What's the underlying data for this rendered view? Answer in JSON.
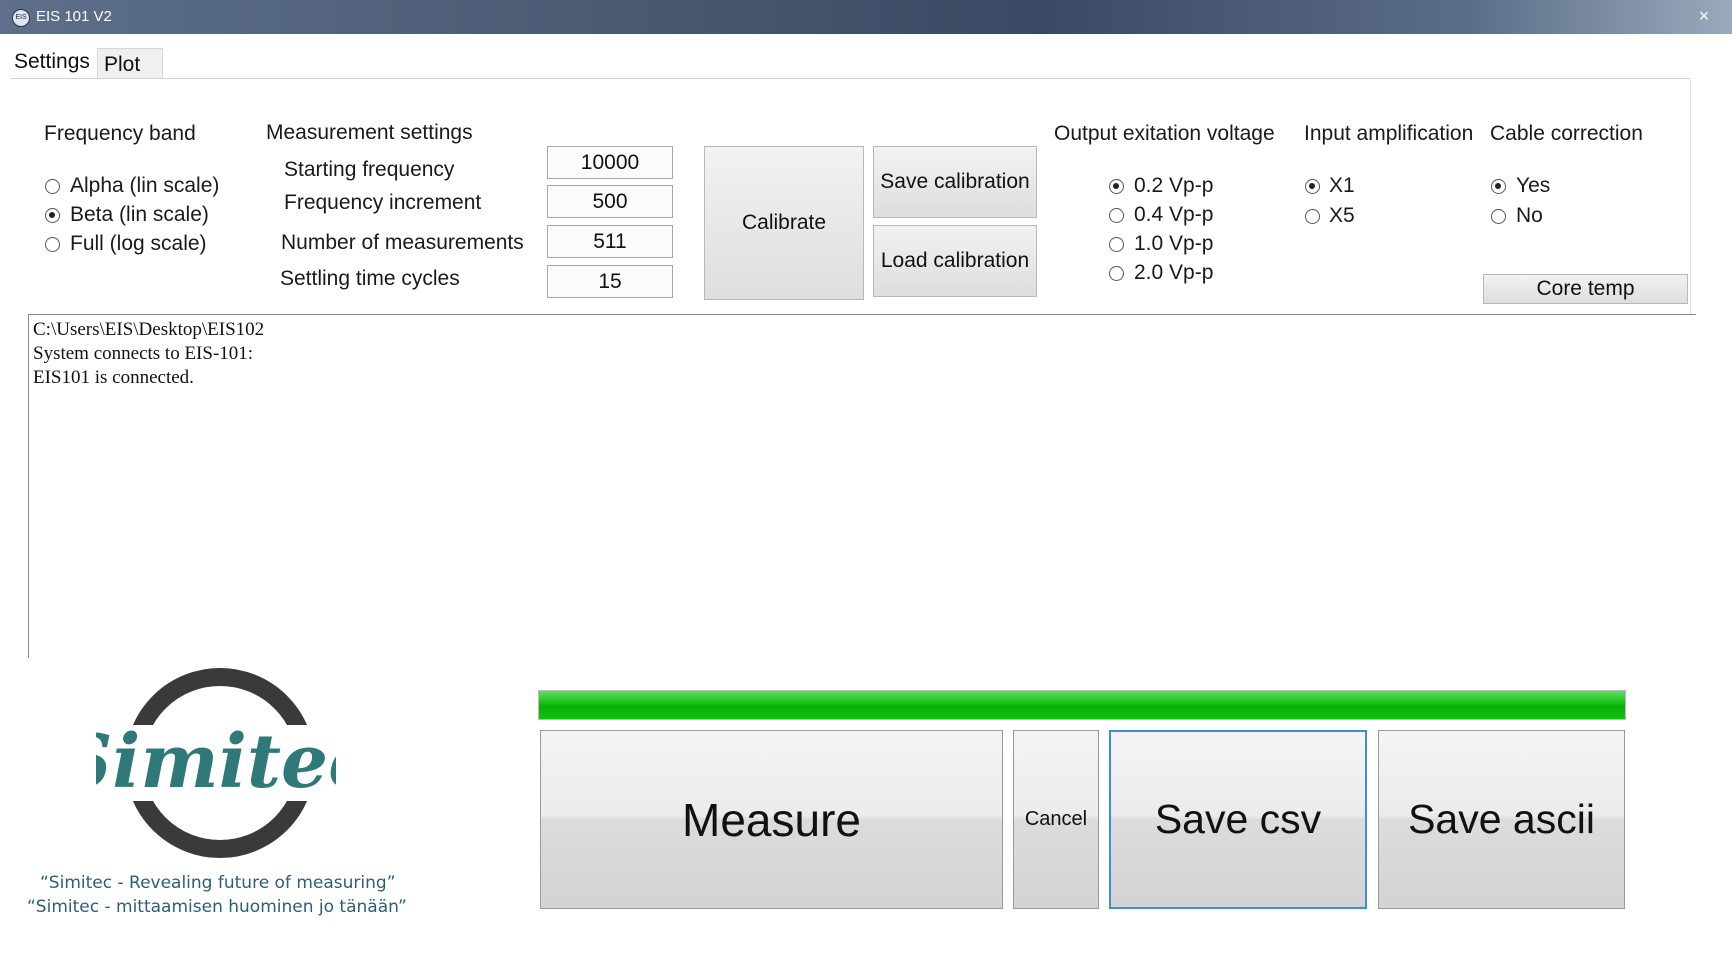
{
  "window": {
    "title": "EIS 101  V2",
    "close_glyph": "×"
  },
  "tabs": [
    {
      "label": "Settings"
    },
    {
      "label": "Plot"
    }
  ],
  "frequency_band": {
    "heading": "Frequency band",
    "options": [
      "Alpha (lin scale)",
      "Beta (lin scale)",
      "Full (log scale)"
    ],
    "selected": "Beta (lin scale)"
  },
  "measurement_settings": {
    "heading": "Measurement settings",
    "fields": [
      {
        "label": "Starting frequency",
        "value": "10000"
      },
      {
        "label": "Frequency increment",
        "value": "500"
      },
      {
        "label": "Number of measurements",
        "value": "511"
      },
      {
        "label": "Settling time cycles",
        "value": "15"
      }
    ]
  },
  "calibration": {
    "calibrate_label": "Calibrate",
    "save_label": "Save calibration",
    "load_label": "Load calibration"
  },
  "output_voltage": {
    "heading": "Output exitation voltage",
    "options": [
      "0.2 Vp-p",
      "0.4 Vp-p",
      "1.0 Vp-p",
      "2.0 Vp-p"
    ],
    "selected": "0.2 Vp-p"
  },
  "input_amplification": {
    "heading": "Input amplification",
    "options": [
      "X1",
      "X5"
    ],
    "selected": "X1"
  },
  "cable_correction": {
    "heading": "Cable correction",
    "options": [
      "Yes",
      "No"
    ],
    "selected": "Yes"
  },
  "core_temp_label": "Core temp",
  "log": {
    "lines": [
      "C:\\Users\\EIS\\Desktop\\EIS102",
      "System connects to EIS-101:",
      "EIS101 is connected."
    ]
  },
  "logo": {
    "brand": "Simitec",
    "tagline_en": "“Simitec - Revealing future of measuring”",
    "tagline_fi": "“Simitec - mittaamisen huominen jo tänään”",
    "ring_color": "#3a3a3a",
    "text_color": "#2f7a78"
  },
  "progress": {
    "percent": 100,
    "color": "#13c013"
  },
  "actions": {
    "measure_label": "Measure",
    "cancel_label": "Cancel",
    "save_csv_label": "Save csv",
    "save_ascii_label": "Save ascii"
  }
}
